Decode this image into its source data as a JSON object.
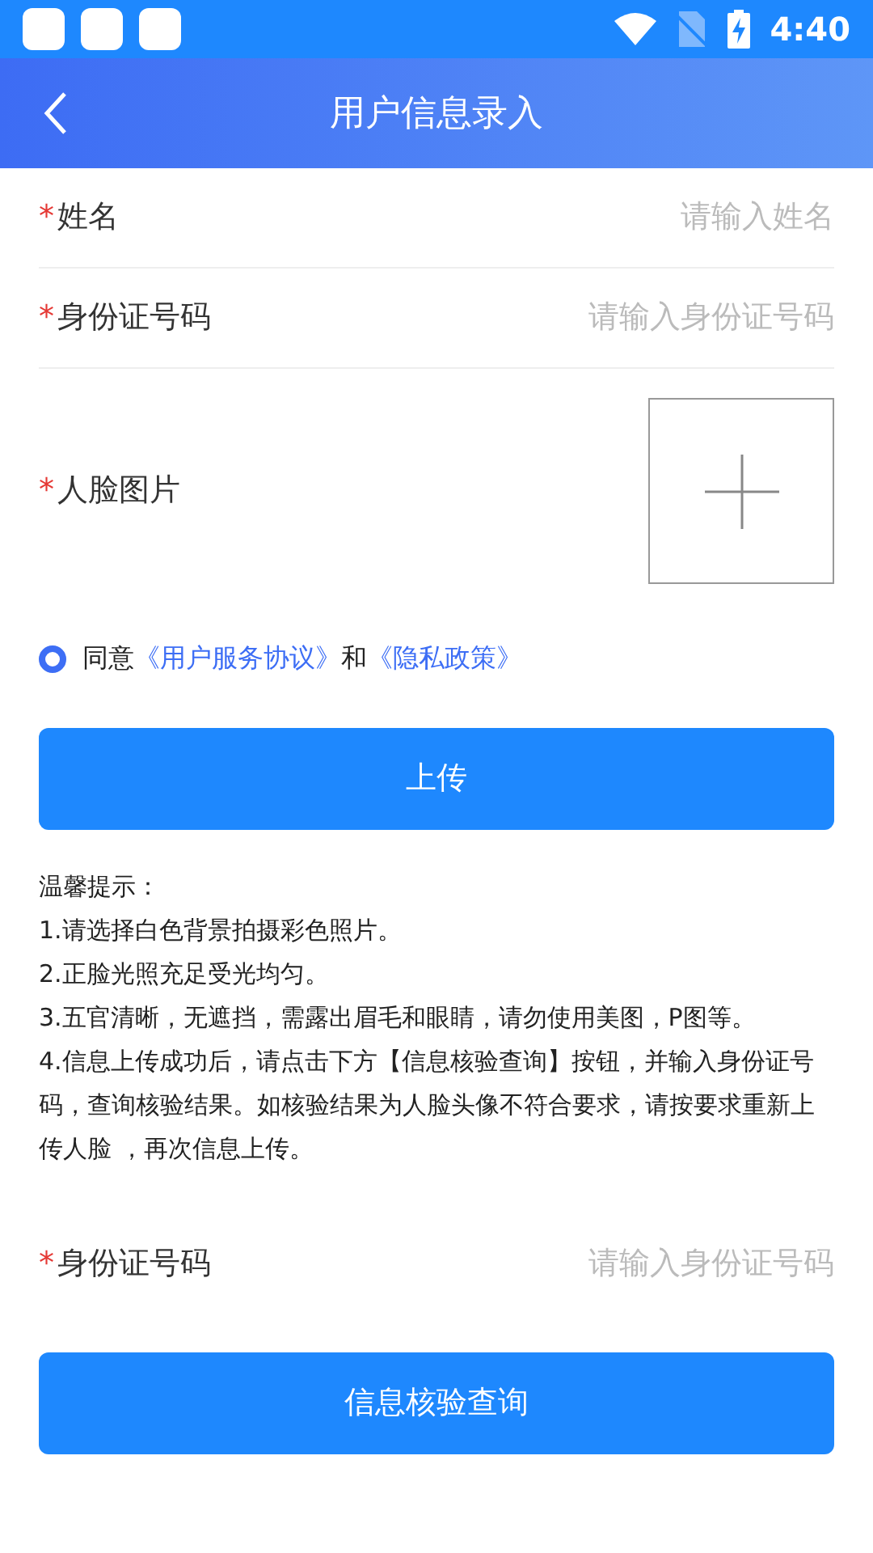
{
  "status_bar": {
    "time": "4:40"
  },
  "header": {
    "title": "用户信息录入"
  },
  "fields": [
    {
      "kind": "text",
      "required_mark": "*",
      "label": "姓名",
      "placeholder": "请输入姓名"
    },
    {
      "kind": "text",
      "required_mark": "*",
      "label": "身份证号码",
      "placeholder": "请输入身份证号码"
    },
    {
      "kind": "photo",
      "required_mark": "*",
      "label": "人脸图片"
    }
  ],
  "agreement": {
    "checked": true,
    "prefix": "同意",
    "link_1": "《用户服务协议》",
    "joiner": "和",
    "link_2": "《隐私政策》"
  },
  "upload_button": "上传",
  "tips": {
    "title": "温馨提示：",
    "items": [
      "1.请选择白色背景拍摄彩色照片。",
      "2.正脸光照充足受光均匀。",
      "3.五官清晰，无遮挡，需露出眉毛和眼睛，请勿使用美图，P图等。",
      "4.信息上传成功后，请点击下方【信息核验查询】按钮，并输入身份证号码，查询核验结果。如核验结果为人脸头像不符合要求，请按要求重新上传人脸 ，再次信息上传。"
    ]
  },
  "query_field": {
    "required_mark": "*",
    "label": "身份证号码",
    "placeholder": "请输入身份证号码"
  },
  "query_button": "信息核验查询"
}
